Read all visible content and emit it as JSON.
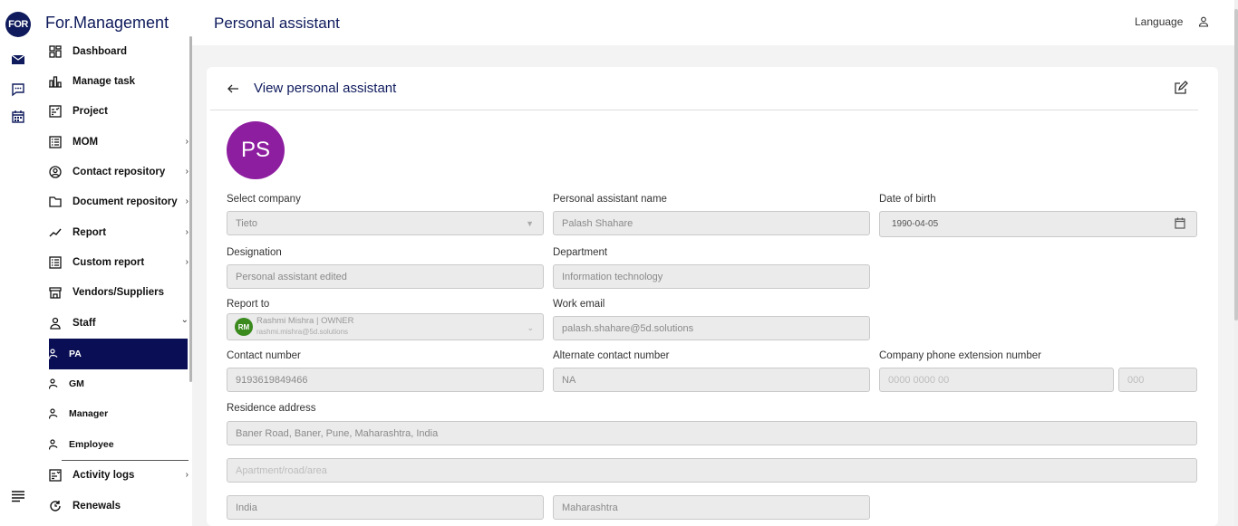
{
  "app": {
    "logo_text": "FOR",
    "brand": "For.Management"
  },
  "header": {
    "title": "Personal assistant",
    "language_label": "Language"
  },
  "rail": {
    "icons": [
      "mail-icon",
      "chat-icon",
      "calendar-icon",
      "menu-icon"
    ]
  },
  "sidebar": {
    "items": [
      {
        "label": "Dashboard",
        "icon": "dashboard-icon",
        "chevron": ""
      },
      {
        "label": "Manage task",
        "icon": "chart-icon",
        "chevron": ""
      },
      {
        "label": "Project",
        "icon": "project-icon",
        "chevron": ""
      },
      {
        "label": "MOM",
        "icon": "list-icon",
        "chevron": "›"
      },
      {
        "label": "Contact repository",
        "icon": "contact-icon",
        "chevron": "›"
      },
      {
        "label": "Document repository",
        "icon": "folder-icon",
        "chevron": "›"
      },
      {
        "label": "Report",
        "icon": "trend-icon",
        "chevron": "›"
      },
      {
        "label": "Custom report",
        "icon": "list-icon",
        "chevron": "›"
      },
      {
        "label": "Vendors/Suppliers",
        "icon": "store-icon",
        "chevron": ""
      },
      {
        "label": "Staff",
        "icon": "person-icon",
        "chevron": "⌄"
      }
    ],
    "staff_sub": [
      {
        "label": "PA",
        "active": true
      },
      {
        "label": "GM",
        "active": false
      },
      {
        "label": "Manager",
        "active": false
      },
      {
        "label": "Employee",
        "active": false
      }
    ],
    "bottom_items": [
      {
        "label": "Activity logs",
        "icon": "activity-icon",
        "chevron": "›"
      },
      {
        "label": "Renewals",
        "icon": "renew-icon",
        "chevron": ""
      }
    ]
  },
  "card": {
    "title": "View personal assistant",
    "avatar_initials": "PS"
  },
  "form": {
    "select_company": {
      "label": "Select company",
      "value": "Tieto"
    },
    "pa_name": {
      "label": "Personal assistant name",
      "value": "Palash Shahare"
    },
    "dob": {
      "label": "Date of birth",
      "value": "1990-04-05"
    },
    "designation": {
      "label": "Designation",
      "value": "Personal assistant edited"
    },
    "department": {
      "label": "Department",
      "value": "Information technology"
    },
    "report_to": {
      "label": "Report to",
      "initials": "RM",
      "name": "Rashmi Mishra | OWNER",
      "email": "rashmi.mishra@5d.solutions"
    },
    "work_email": {
      "label": "Work email",
      "value": "palash.shahare@5d.solutions"
    },
    "contact_number": {
      "label": "Contact number",
      "value": "9193619849466"
    },
    "alt_contact": {
      "label": "Alternate contact number",
      "value": "NA"
    },
    "phone_ext": {
      "label": "Company phone extension number",
      "placeholder": "0000 0000 00",
      "ext_placeholder": "000"
    },
    "residence": {
      "label": "Residence address",
      "value": "Baner Road, Baner, Pune, Maharashtra, India",
      "apartment_placeholder": "Apartment/road/area"
    },
    "country": {
      "value": "India"
    },
    "state": {
      "value": "Maharashtra"
    }
  }
}
